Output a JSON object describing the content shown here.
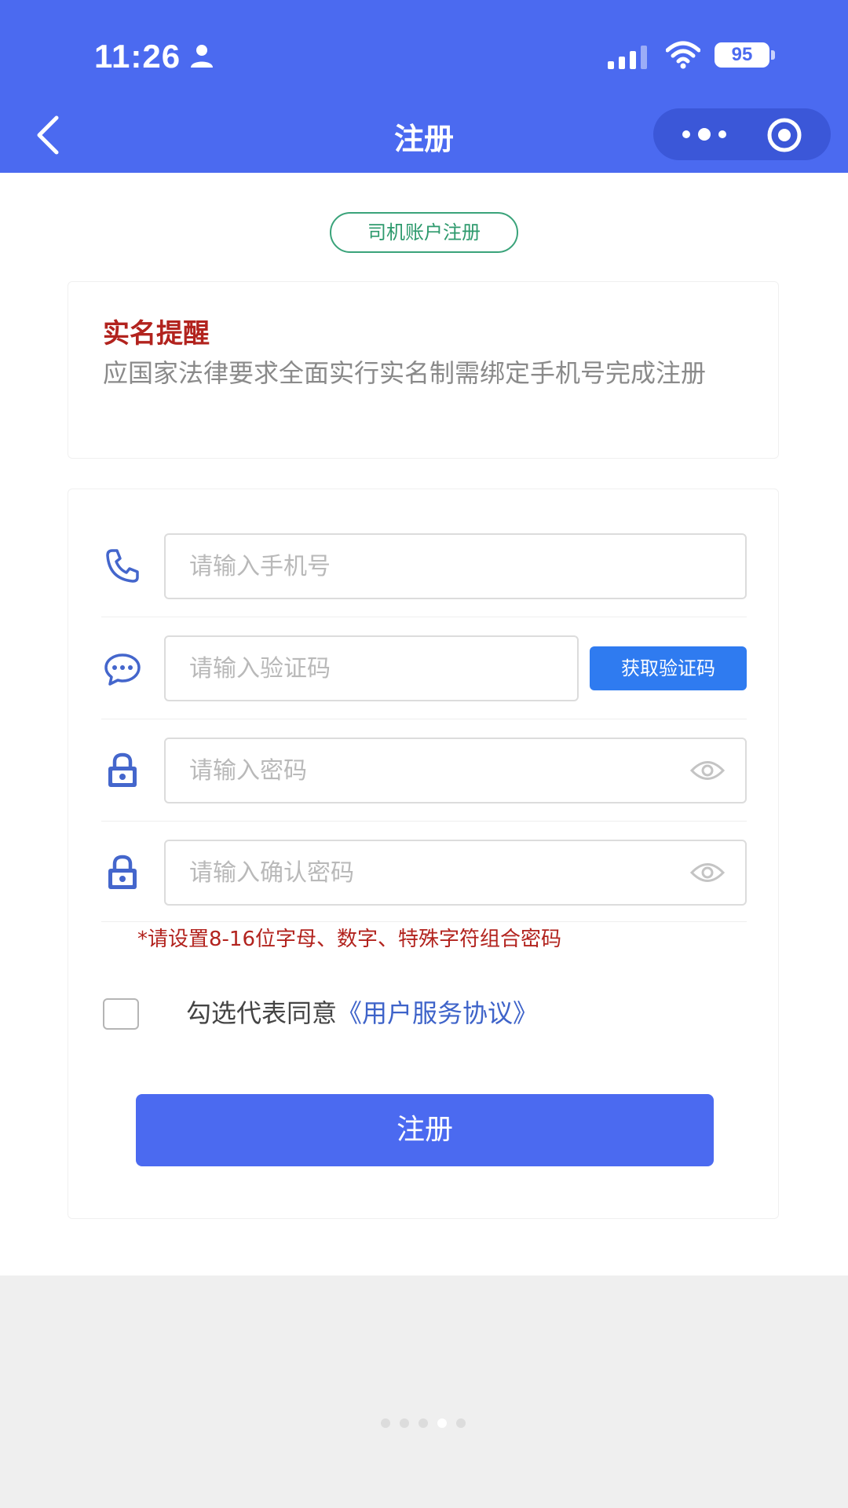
{
  "status_bar": {
    "time": "11:26",
    "battery": "95"
  },
  "nav": {
    "title": "注册"
  },
  "tag": "司机账户注册",
  "notice": {
    "title": "实名提醒",
    "body": "应国家法律要求全面实行实名制需绑定手机号完成注册"
  },
  "form": {
    "phone_placeholder": "请输入手机号",
    "code_placeholder": "请输入验证码",
    "get_code_label": "获取验证码",
    "password_placeholder": "请输入密码",
    "confirm_placeholder": "请输入确认密码",
    "password_hint": "*请设置8-16位字母、数字、特殊字符组合密码",
    "agree_text": "勾选代表同意",
    "agreement_link": "《用户服务协议》",
    "submit_label": "注册"
  },
  "pager": {
    "count": 5,
    "active_index": 3
  },
  "colors": {
    "primary": "#4b6af0",
    "accent_blue": "#2f7bf0",
    "warning_red": "#b2231e",
    "tag_green": "#2e9a6d",
    "link_blue": "#3e63c9"
  },
  "icons": [
    "person-icon",
    "signal-icon",
    "wifi-icon",
    "back-icon",
    "more-icon",
    "close-capsule-icon",
    "phone-icon",
    "chat-icon",
    "lock-icon",
    "eye-icon"
  ]
}
